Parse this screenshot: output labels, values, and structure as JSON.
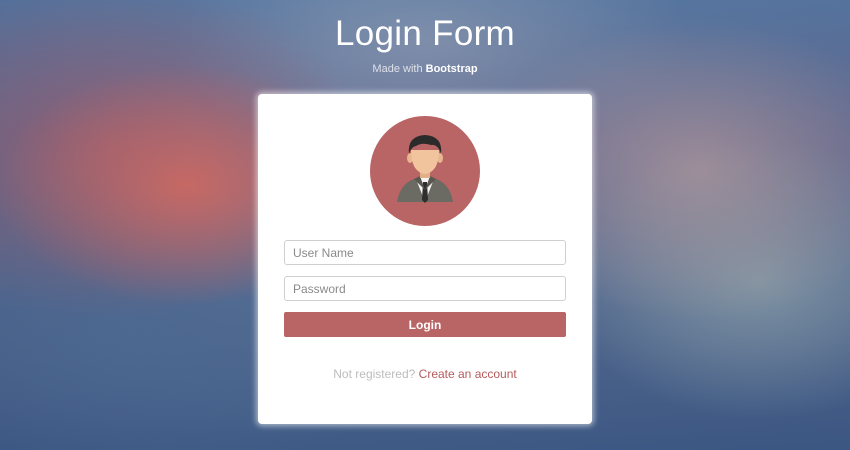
{
  "page": {
    "title": "Login Form",
    "subtitle_prefix": "Made with",
    "subtitle_brand": "Bootstrap"
  },
  "login_card": {
    "avatar_icon": "user-avatar-icon",
    "username_placeholder": "User Name",
    "password_placeholder": "Password",
    "login_label": "Login",
    "register_prompt": "Not registered?",
    "register_link": "Create an account"
  },
  "colors": {
    "accent": "#b96465",
    "link": "#b55a5c",
    "card_background": "#ffffff"
  }
}
